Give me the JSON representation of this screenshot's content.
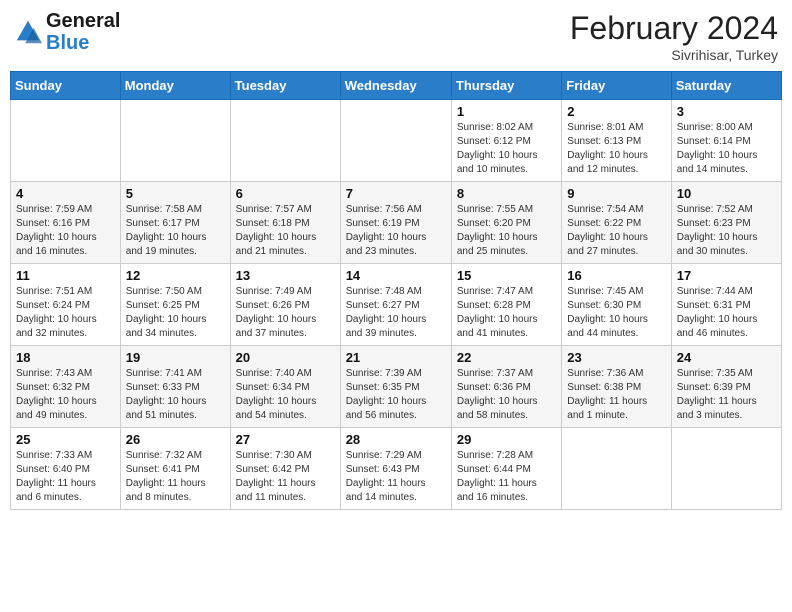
{
  "header": {
    "logo_line1": "General",
    "logo_line2": "Blue",
    "month_year": "February 2024",
    "location": "Sivrihisar, Turkey"
  },
  "weekdays": [
    "Sunday",
    "Monday",
    "Tuesday",
    "Wednesday",
    "Thursday",
    "Friday",
    "Saturday"
  ],
  "weeks": [
    [
      {
        "day": "",
        "info": ""
      },
      {
        "day": "",
        "info": ""
      },
      {
        "day": "",
        "info": ""
      },
      {
        "day": "",
        "info": ""
      },
      {
        "day": "1",
        "info": "Sunrise: 8:02 AM\nSunset: 6:12 PM\nDaylight: 10 hours\nand 10 minutes."
      },
      {
        "day": "2",
        "info": "Sunrise: 8:01 AM\nSunset: 6:13 PM\nDaylight: 10 hours\nand 12 minutes."
      },
      {
        "day": "3",
        "info": "Sunrise: 8:00 AM\nSunset: 6:14 PM\nDaylight: 10 hours\nand 14 minutes."
      }
    ],
    [
      {
        "day": "4",
        "info": "Sunrise: 7:59 AM\nSunset: 6:16 PM\nDaylight: 10 hours\nand 16 minutes."
      },
      {
        "day": "5",
        "info": "Sunrise: 7:58 AM\nSunset: 6:17 PM\nDaylight: 10 hours\nand 19 minutes."
      },
      {
        "day": "6",
        "info": "Sunrise: 7:57 AM\nSunset: 6:18 PM\nDaylight: 10 hours\nand 21 minutes."
      },
      {
        "day": "7",
        "info": "Sunrise: 7:56 AM\nSunset: 6:19 PM\nDaylight: 10 hours\nand 23 minutes."
      },
      {
        "day": "8",
        "info": "Sunrise: 7:55 AM\nSunset: 6:20 PM\nDaylight: 10 hours\nand 25 minutes."
      },
      {
        "day": "9",
        "info": "Sunrise: 7:54 AM\nSunset: 6:22 PM\nDaylight: 10 hours\nand 27 minutes."
      },
      {
        "day": "10",
        "info": "Sunrise: 7:52 AM\nSunset: 6:23 PM\nDaylight: 10 hours\nand 30 minutes."
      }
    ],
    [
      {
        "day": "11",
        "info": "Sunrise: 7:51 AM\nSunset: 6:24 PM\nDaylight: 10 hours\nand 32 minutes."
      },
      {
        "day": "12",
        "info": "Sunrise: 7:50 AM\nSunset: 6:25 PM\nDaylight: 10 hours\nand 34 minutes."
      },
      {
        "day": "13",
        "info": "Sunrise: 7:49 AM\nSunset: 6:26 PM\nDaylight: 10 hours\nand 37 minutes."
      },
      {
        "day": "14",
        "info": "Sunrise: 7:48 AM\nSunset: 6:27 PM\nDaylight: 10 hours\nand 39 minutes."
      },
      {
        "day": "15",
        "info": "Sunrise: 7:47 AM\nSunset: 6:28 PM\nDaylight: 10 hours\nand 41 minutes."
      },
      {
        "day": "16",
        "info": "Sunrise: 7:45 AM\nSunset: 6:30 PM\nDaylight: 10 hours\nand 44 minutes."
      },
      {
        "day": "17",
        "info": "Sunrise: 7:44 AM\nSunset: 6:31 PM\nDaylight: 10 hours\nand 46 minutes."
      }
    ],
    [
      {
        "day": "18",
        "info": "Sunrise: 7:43 AM\nSunset: 6:32 PM\nDaylight: 10 hours\nand 49 minutes."
      },
      {
        "day": "19",
        "info": "Sunrise: 7:41 AM\nSunset: 6:33 PM\nDaylight: 10 hours\nand 51 minutes."
      },
      {
        "day": "20",
        "info": "Sunrise: 7:40 AM\nSunset: 6:34 PM\nDaylight: 10 hours\nand 54 minutes."
      },
      {
        "day": "21",
        "info": "Sunrise: 7:39 AM\nSunset: 6:35 PM\nDaylight: 10 hours\nand 56 minutes."
      },
      {
        "day": "22",
        "info": "Sunrise: 7:37 AM\nSunset: 6:36 PM\nDaylight: 10 hours\nand 58 minutes."
      },
      {
        "day": "23",
        "info": "Sunrise: 7:36 AM\nSunset: 6:38 PM\nDaylight: 11 hours\nand 1 minute."
      },
      {
        "day": "24",
        "info": "Sunrise: 7:35 AM\nSunset: 6:39 PM\nDaylight: 11 hours\nand 3 minutes."
      }
    ],
    [
      {
        "day": "25",
        "info": "Sunrise: 7:33 AM\nSunset: 6:40 PM\nDaylight: 11 hours\nand 6 minutes."
      },
      {
        "day": "26",
        "info": "Sunrise: 7:32 AM\nSunset: 6:41 PM\nDaylight: 11 hours\nand 8 minutes."
      },
      {
        "day": "27",
        "info": "Sunrise: 7:30 AM\nSunset: 6:42 PM\nDaylight: 11 hours\nand 11 minutes."
      },
      {
        "day": "28",
        "info": "Sunrise: 7:29 AM\nSunset: 6:43 PM\nDaylight: 11 hours\nand 14 minutes."
      },
      {
        "day": "29",
        "info": "Sunrise: 7:28 AM\nSunset: 6:44 PM\nDaylight: 11 hours\nand 16 minutes."
      },
      {
        "day": "",
        "info": ""
      },
      {
        "day": "",
        "info": ""
      }
    ]
  ]
}
